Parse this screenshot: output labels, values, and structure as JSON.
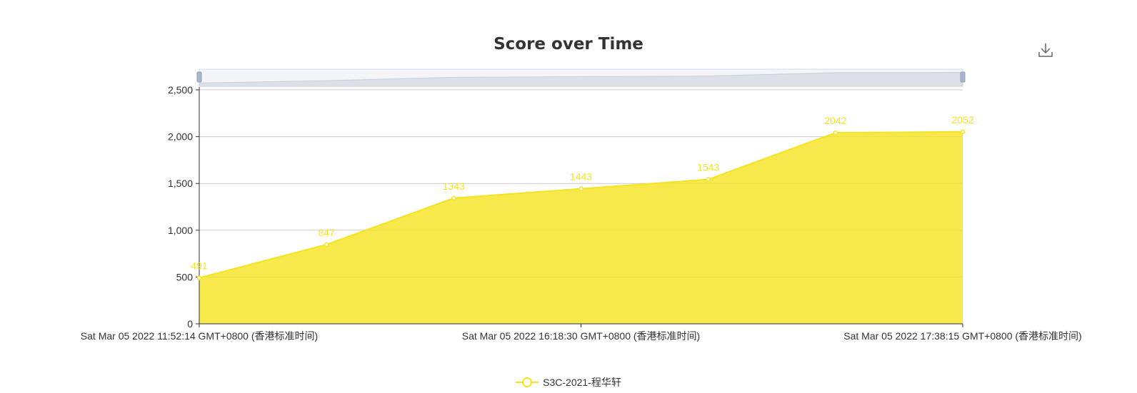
{
  "chart_data": {
    "type": "area",
    "title": "Score over Time",
    "xlabel": "",
    "ylabel": "",
    "ylim": [
      0,
      2500
    ],
    "yticks": [
      0,
      500,
      1000,
      1500,
      2000,
      2500
    ],
    "ytick_labels": [
      "0",
      "500",
      "1,000",
      "1,500",
      "2,000",
      "2,500"
    ],
    "x": [
      "Sat Mar 05 2022 11:52:14 GMT+0800 (香港标准时间)",
      "",
      "",
      "",
      "Sat Mar 05 2022 16:18:30 GMT+0800 (香港标准时间)",
      "",
      "",
      "Sat Mar 05 2022 17:38:15 GMT+0800 (香港标准时间)"
    ],
    "xtick_labels": [
      "Sat Mar 05 2022 11:52:14 GMT+0800 (香港标准时间)",
      "Sat Mar 05 2022 16:18:30 GMT+0800 (香港标准时间)",
      "Sat Mar 05 2022 17:38:15 GMT+0800 (香港标准时间)"
    ],
    "series": [
      {
        "name": "S3C-2021-程华轩",
        "values": [
          491,
          847,
          1343,
          1443,
          1543,
          2042,
          2052
        ],
        "color": "#f5e41f"
      }
    ],
    "grid": true,
    "legend": "bottom-center",
    "data_zoom": "top"
  }
}
